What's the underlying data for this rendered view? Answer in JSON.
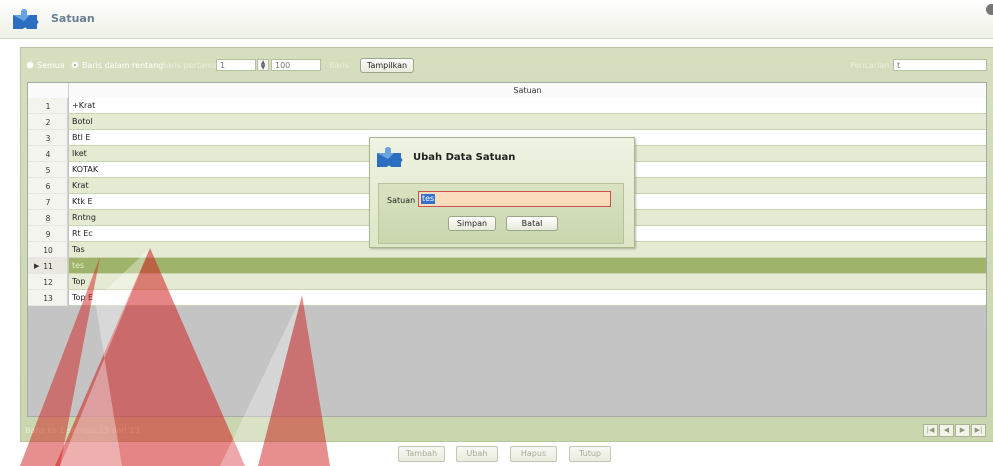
{
  "window": {
    "title": "Satuan",
    "icon": "puzzle-icon"
  },
  "filter": {
    "semua_label": "Semua",
    "rentang_label": "Baris dalam rentang",
    "baris_pertama_label": "Baris pertama",
    "baris_pertama_value": "1",
    "baris_count_value": "100",
    "baris_label": "Baris",
    "tampilkan_label": "Tampilkan",
    "pencarian_label": "Pencarian",
    "pencarian_value": "t"
  },
  "grid": {
    "column_header": "Satuan",
    "rows": [
      {
        "no": "1",
        "satuan": "+Krat"
      },
      {
        "no": "2",
        "satuan": "Botol"
      },
      {
        "no": "3",
        "satuan": "Btl E"
      },
      {
        "no": "4",
        "satuan": "Iket"
      },
      {
        "no": "5",
        "satuan": "KOTAK"
      },
      {
        "no": "6",
        "satuan": "Krat"
      },
      {
        "no": "7",
        "satuan": "Ktk E"
      },
      {
        "no": "8",
        "satuan": "Rntng"
      },
      {
        "no": "9",
        "satuan": "Rt Ec"
      },
      {
        "no": "10",
        "satuan": "Tas"
      },
      {
        "no": "11",
        "satuan": "tes"
      },
      {
        "no": "12",
        "satuan": "Top"
      },
      {
        "no": "13",
        "satuan": "Top E"
      }
    ],
    "selected_row_no": "11",
    "status_text": "Baris ke 1 sampai 13 dari 13"
  },
  "nav": {
    "first": "first-page-icon",
    "prev": "prev-page-icon",
    "next": "next-page-icon",
    "last": "last-page-icon"
  },
  "actions": {
    "tambah": "Tambah",
    "ubah": "Ubah",
    "hapus": "Hapus",
    "tutup": "Tutup"
  },
  "dialog": {
    "title": "Ubah Data Satuan",
    "field_label": "Satuan",
    "field_value": "tes",
    "simpan": "Simpan",
    "batal": "Batal"
  },
  "colors": {
    "panel_green": "#c9d6ae",
    "row_alt": "#e4ebd2",
    "row_selected": "#9fb36b",
    "input_error_border": "#d05050",
    "input_bg": "#fbdcbc",
    "watermark_red": "#d02020"
  }
}
